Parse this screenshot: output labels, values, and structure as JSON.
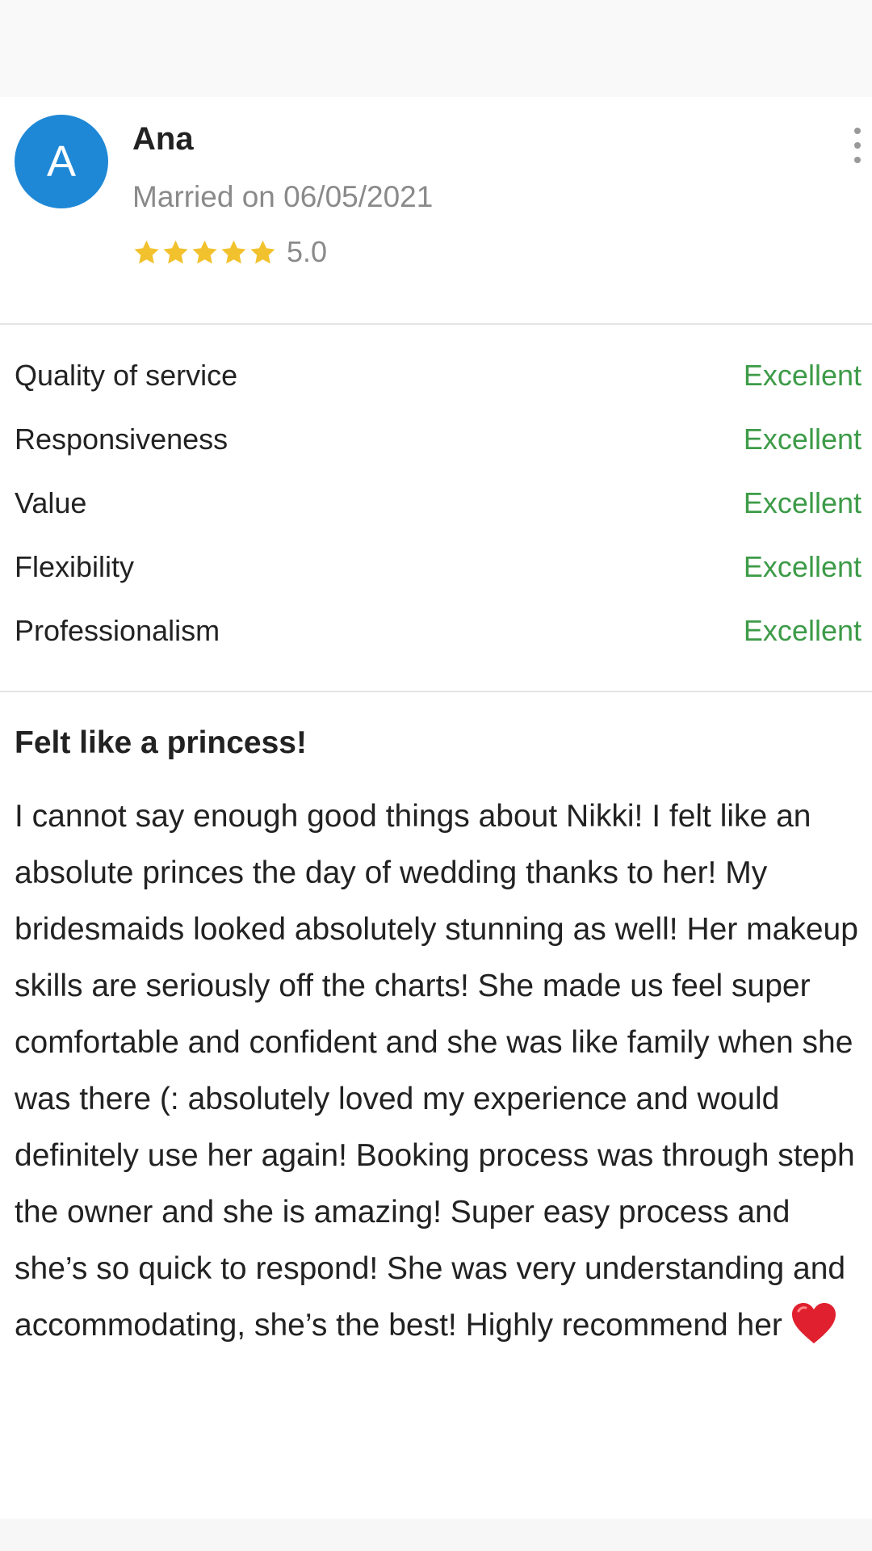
{
  "review": {
    "avatar_initial": "A",
    "reviewer_name": "Ana",
    "married_text": "Married on 06/05/2021",
    "overall_rating": "5.0",
    "stars_filled": 5,
    "stars_total": 5,
    "ratings": [
      {
        "label": "Quality of service",
        "value": "Excellent"
      },
      {
        "label": "Responsiveness",
        "value": "Excellent"
      },
      {
        "label": "Value",
        "value": "Excellent"
      },
      {
        "label": "Flexibility",
        "value": "Excellent"
      },
      {
        "label": "Professionalism",
        "value": "Excellent"
      }
    ],
    "title": "Felt like a princess!",
    "body": "I cannot say enough good things about Nikki! I felt like an absolute princes the day of wedding thanks to her! My bridesmaids looked absolutely stunning as well! Her makeup skills are seriously off the charts! She made us feel super comfortable and confident and she was like family when she was there (: absolutely loved my experience and would definitely use her again! Booking process was through steph the owner and she is amazing! Super easy process and she’s so quick to respond! She was very understanding and accommodating, she’s the best! Highly recommend her"
  },
  "icons": {
    "star": "star-icon",
    "more": "more-vertical-icon",
    "heart": "red-heart-icon"
  },
  "colors": {
    "avatar_bg": "#1e88d6",
    "star": "#f2c22e",
    "excellent": "#3d9b48",
    "muted_text": "#8a8a8a",
    "heart": "#e0202e"
  }
}
